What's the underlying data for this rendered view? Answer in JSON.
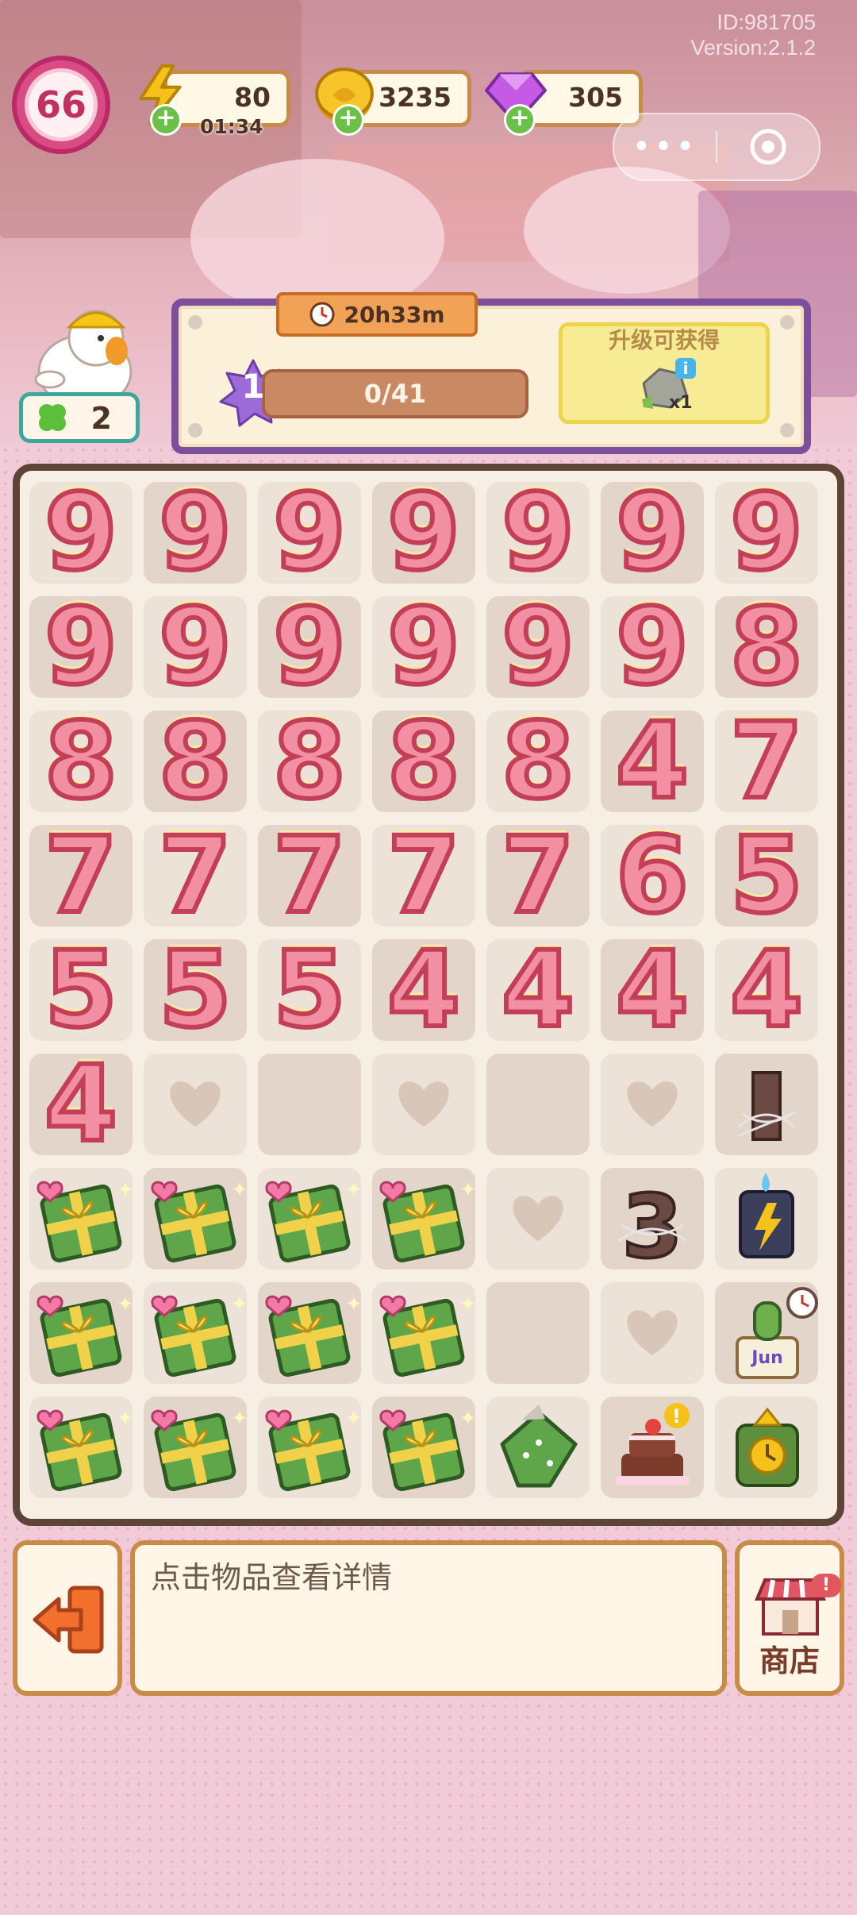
{
  "system": {
    "id_text": "ID:981705",
    "version_text": "Version:2.1.2"
  },
  "player": {
    "level": "66"
  },
  "resources": {
    "energy": {
      "value": "80",
      "timer": "01:34",
      "icon": "lightning-icon",
      "color": "#f5c11b"
    },
    "coins": {
      "value": "3235",
      "icon": "coin-icon",
      "color": "#f2b81c"
    },
    "gems": {
      "value": "305",
      "icon": "gem-icon",
      "color": "#b34ad6"
    }
  },
  "capsule": {
    "more_label": "•••",
    "close_icon": "target-icon"
  },
  "helper": {
    "leaf_count": "2"
  },
  "quest": {
    "timer": "20h33m",
    "level": "1",
    "progress_text": "0/41",
    "progress": 0,
    "reward_title": "升级可获得",
    "reward_qty": "x1",
    "reward_icon": "stone-icon"
  },
  "board": {
    "rows": [
      [
        {
          "t": "num",
          "v": "9"
        },
        {
          "t": "num",
          "v": "9"
        },
        {
          "t": "num",
          "v": "9"
        },
        {
          "t": "num",
          "v": "9"
        },
        {
          "t": "num",
          "v": "9"
        },
        {
          "t": "num",
          "v": "9"
        },
        {
          "t": "num",
          "v": "9"
        }
      ],
      [
        {
          "t": "num",
          "v": "9"
        },
        {
          "t": "num",
          "v": "9"
        },
        {
          "t": "num",
          "v": "9"
        },
        {
          "t": "num",
          "v": "9"
        },
        {
          "t": "num",
          "v": "9"
        },
        {
          "t": "num",
          "v": "9"
        },
        {
          "t": "num",
          "v": "8"
        }
      ],
      [
        {
          "t": "num",
          "v": "8"
        },
        {
          "t": "num",
          "v": "8"
        },
        {
          "t": "num",
          "v": "8"
        },
        {
          "t": "num",
          "v": "8"
        },
        {
          "t": "num",
          "v": "8"
        },
        {
          "t": "num",
          "v": "4"
        },
        {
          "t": "num",
          "v": "7"
        }
      ],
      [
        {
          "t": "num",
          "v": "7"
        },
        {
          "t": "num",
          "v": "7"
        },
        {
          "t": "num",
          "v": "7"
        },
        {
          "t": "num",
          "v": "7"
        },
        {
          "t": "num",
          "v": "7"
        },
        {
          "t": "num",
          "v": "6"
        },
        {
          "t": "num",
          "v": "5"
        }
      ],
      [
        {
          "t": "num",
          "v": "5"
        },
        {
          "t": "num",
          "v": "5"
        },
        {
          "t": "num",
          "v": "5"
        },
        {
          "t": "num",
          "v": "4"
        },
        {
          "t": "num",
          "v": "4"
        },
        {
          "t": "num",
          "v": "4"
        },
        {
          "t": "num",
          "v": "4"
        }
      ],
      [
        {
          "t": "num",
          "v": "4"
        },
        {
          "t": "heart"
        },
        {
          "t": "empty"
        },
        {
          "t": "heart"
        },
        {
          "t": "empty"
        },
        {
          "t": "heart"
        },
        {
          "t": "cobweb-candle-1"
        }
      ],
      [
        {
          "t": "gift"
        },
        {
          "t": "gift"
        },
        {
          "t": "gift"
        },
        {
          "t": "gift"
        },
        {
          "t": "heart"
        },
        {
          "t": "cobweb-candle-3"
        },
        {
          "t": "lightning-box"
        }
      ],
      [
        {
          "t": "gift"
        },
        {
          "t": "gift"
        },
        {
          "t": "gift"
        },
        {
          "t": "gift"
        },
        {
          "t": "empty"
        },
        {
          "t": "heart"
        },
        {
          "t": "cactus-calendar"
        }
      ],
      [
        {
          "t": "gift"
        },
        {
          "t": "gift"
        },
        {
          "t": "gift"
        },
        {
          "t": "gift"
        },
        {
          "t": "open-gift"
        },
        {
          "t": "cake"
        },
        {
          "t": "gold-clock-box"
        }
      ]
    ]
  },
  "bottom": {
    "hint": "点击物品查看详情",
    "shop_label": "商店",
    "exit_icon": "exit-icon",
    "shop_badge": "!"
  }
}
